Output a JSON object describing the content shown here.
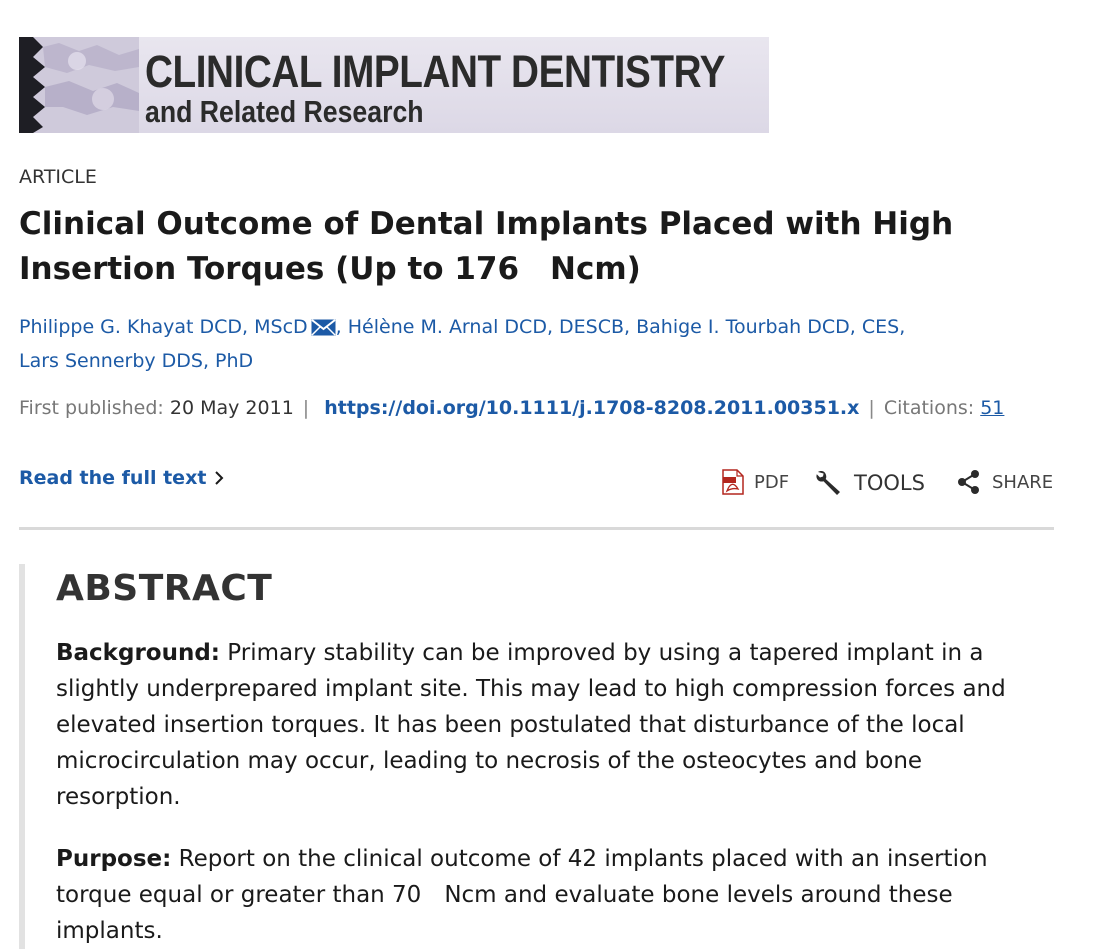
{
  "journal": {
    "line1": "CLINICAL IMPLANT DENTISTRY",
    "line2": "and Related Research"
  },
  "article": {
    "type": "ARTICLE",
    "title": "Clinical Outcome of Dental Implants Placed with High Insertion Torques (Up to 176 Ncm)",
    "authors": [
      "Philippe G. Khayat DCD, MScD",
      "Hélène M. Arnal DCD, DESCB",
      "Bahige I. Tourbah DCD, CES",
      "Lars Sennerby DDS, PhD"
    ],
    "first_published_label": "First published:",
    "first_published_value": "20 May 2011",
    "doi": "https://doi.org/10.1111/j.1708-8208.2011.00351.x",
    "citations_label": "Citations:",
    "citations_value": "51"
  },
  "actions": {
    "read_full": "Read the full text",
    "pdf": "PDF",
    "tools": "TOOLS",
    "share": "SHARE"
  },
  "icons": {
    "mail": "envelope-icon",
    "chevron": "chevron-right-icon",
    "pdf": "pdf-file-icon",
    "tools": "wrench-icon",
    "share": "share-icon"
  },
  "abstract": {
    "heading": "ABSTRACT",
    "background_label": "Background:",
    "background_text": " Primary stability can be improved by using a tapered implant in a slightly underprepared implant site. This may lead to high compression forces and elevated insertion torques. It has been postulated that disturbance of the local microcirculation may occur, leading to necrosis of the osteocytes and bone resorption.",
    "purpose_label": "Purpose:",
    "purpose_text": " Report on the clinical outcome of 42 implants placed with an insertion torque equal or greater than 70 Ncm and evaluate bone levels around these implants."
  },
  "colors": {
    "link": "#1c5aa6",
    "divider": "#d9d9d9",
    "banner_bg": "#e9e6ef"
  }
}
